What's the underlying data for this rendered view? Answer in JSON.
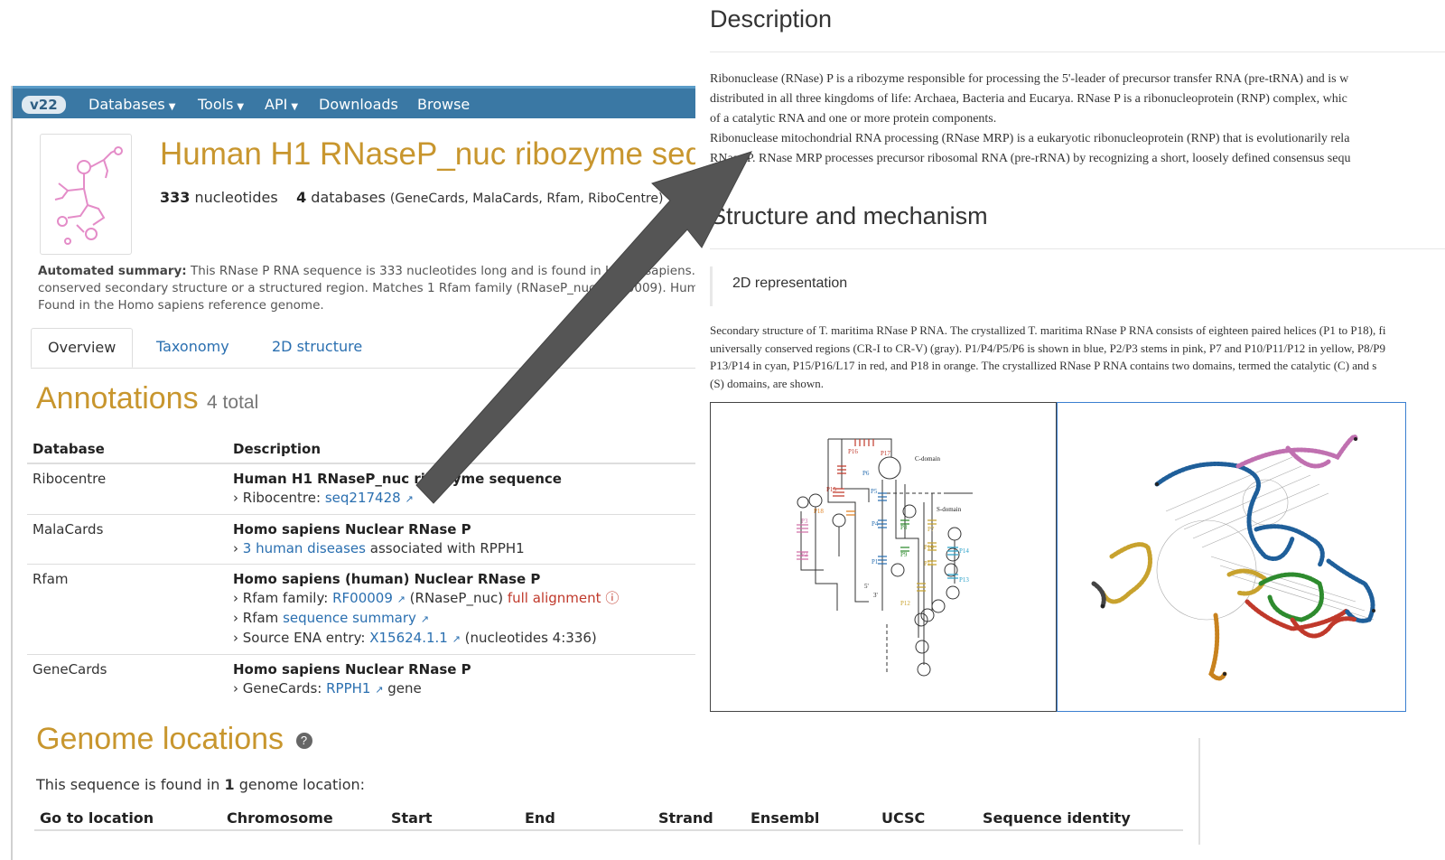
{
  "navbar": {
    "version_badge": "v22",
    "items": [
      {
        "label": "Databases",
        "dropdown": true
      },
      {
        "label": "Tools",
        "dropdown": true
      },
      {
        "label": "API",
        "dropdown": true
      },
      {
        "label": "Downloads",
        "dropdown": false
      },
      {
        "label": "Browse",
        "dropdown": false
      }
    ]
  },
  "header": {
    "title": "Human H1 RNaseP_nuc ribozyme seque",
    "nucleotide_count": "333",
    "nucleotides_label": "nucleotides",
    "database_count": "4",
    "databases_label": "databases",
    "databases_list": "(GeneCards, MalaCards, Rfam, RiboCentre)"
  },
  "summary": {
    "label": "Automated summary:",
    "line1": "This RNase P RNA sequence is 333 nucleotides long and is found in Homo sapiens.",
    "line2": "conserved secondary structure or a structured region. Matches 1 Rfam family (RNaseP_nuc, RF00009). Hum",
    "line3": "Found in the Homo sapiens reference genome."
  },
  "tabs": [
    {
      "label": "Overview",
      "active": true
    },
    {
      "label": "Taxonomy",
      "active": false
    },
    {
      "label": "2D structure",
      "active": false
    }
  ],
  "annotations": {
    "title": "Annotations",
    "count": "4 total",
    "headers": {
      "database": "Database",
      "description": "Description"
    },
    "rows": [
      {
        "db": "Ribocentre",
        "title": "Human H1 RNaseP_nuc ribozyme sequence",
        "l1_prefix": "Ribocentre:",
        "l1_link": "seq217428"
      },
      {
        "db": "MalaCards",
        "title": "Homo sapiens Nuclear RNase P",
        "l1_link": "3 human diseases",
        "l1_suffix": "associated with RPPH1"
      },
      {
        "db": "Rfam",
        "title": "Homo sapiens (human) Nuclear RNase P",
        "l1_prefix": "Rfam family:",
        "l1_link": "RF00009",
        "l1_mid": "(RNaseP_nuc)",
        "l1_red": "full alignment",
        "l2_prefix": "Rfam",
        "l2_link": "sequence summary",
        "l3_prefix": "Source ENA entry:",
        "l3_link": "X15624.1.1",
        "l3_suffix": "(nucleotides 4:336)"
      },
      {
        "db": "GeneCards",
        "title": "Homo sapiens Nuclear RNase P",
        "l1_prefix": "GeneCards:",
        "l1_link": "RPPH1",
        "l1_suffix": "gene"
      }
    ]
  },
  "genome": {
    "title": "Genome locations",
    "text_prefix": "This sequence is found in",
    "text_count": "1",
    "text_suffix": "genome location:",
    "columns": [
      "Go to location",
      "Chromosome",
      "Start",
      "End",
      "Strand",
      "Ensembl",
      "UCSC",
      "Sequence identity"
    ]
  },
  "rfam": {
    "description_heading": "Description",
    "description_lines": [
      "Ribonuclease (RNase) P is a ribozyme responsible for processing the 5'-leader of precursor transfer RNA (pre-tRNA) and is w",
      "distributed in all three kingdoms of life: Archaea, Bacteria and Eucarya. RNase P is a ribonucleoprotein (RNP) complex, whic",
      "of a catalytic RNA and one or more protein components.",
      "Ribonuclease mitochondrial RNA processing (RNase MRP) is a eukaryotic ribonucleoprotein (RNP) that is evolutionarily rela",
      "RNase P. RNase MRP processes precursor ribosomal RNA (pre-rRNA) by recognizing a short, loosely defined consensus sequ"
    ],
    "structure_heading": "Structure and mechanism",
    "representation_label": "2D representation",
    "caption_lines": [
      "Secondary structure of T. maritima RNase P RNA. The crystallized T. maritima RNase P RNA consists of eighteen paired helices (P1 to P18), fi",
      "universally conserved regions (CR-I to CR-V) (gray). P1/P4/P5/P6 is shown in blue, P2/P3 stems in pink, P7 and P10/P11/P12 in yellow, P8/P9",
      "P13/P14 in cyan, P15/P16/L17 in red, and P18 in orange. The crystallized RNase P RNA contains two domains, termed the catalytic (C) and s",
      "(S) domains, are shown."
    ],
    "diagram_labels": {
      "c_domain": "C-domain",
      "s_domain": "S-domain",
      "helices": [
        "P1",
        "P2",
        "P3",
        "P4",
        "P5",
        "P6",
        "P7",
        "P8",
        "P9",
        "P10",
        "P11",
        "P12",
        "P13",
        "P14",
        "P15",
        "P16",
        "P17",
        "P18"
      ],
      "ends": [
        "5'",
        "3'"
      ]
    }
  },
  "colors": {
    "navbar": "#3a78a4",
    "heading_gold": "#c8962e",
    "link": "#2a6fb0",
    "alert_red": "#c0392b",
    "arrow": "#555555"
  }
}
